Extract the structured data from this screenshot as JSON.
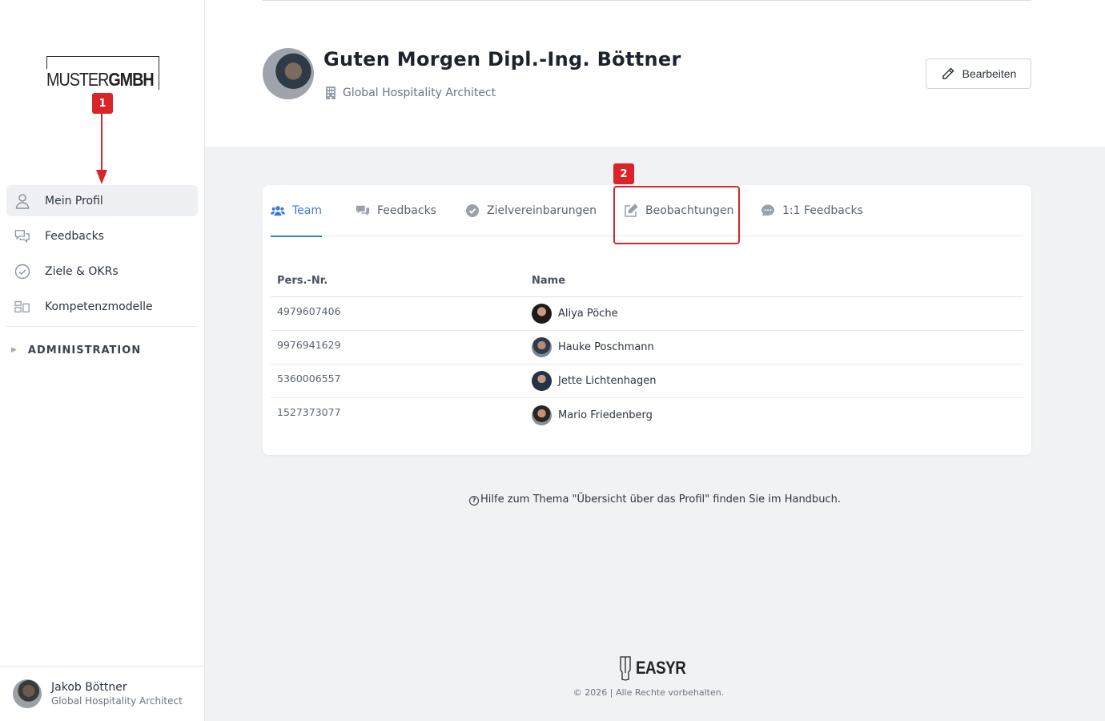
{
  "sidebar": {
    "logo": {
      "part1": "MUSTER",
      "part2": "GMBH"
    },
    "items": [
      {
        "label": "Mein Profil",
        "icon": "user-icon",
        "active": true
      },
      {
        "label": "Feedbacks",
        "icon": "chat-bubbles-icon",
        "active": false
      },
      {
        "label": "Ziele & OKRs",
        "icon": "check-circle-icon",
        "active": false
      },
      {
        "label": "Kompetenzmodelle",
        "icon": "model-blocks-icon",
        "active": false
      }
    ],
    "admin_label": "ADMINISTRATION",
    "user": {
      "name": "Jakob Böttner",
      "role": "Global Hospitality Architect"
    }
  },
  "header": {
    "greeting": "Guten Morgen Dipl.-Ing. Böttner",
    "role": "Global Hospitality Architect",
    "edit_label": "Bearbeiten"
  },
  "tabs": [
    {
      "label": "Team",
      "icon": "users-icon",
      "active": true
    },
    {
      "label": "Feedbacks",
      "icon": "comments-icon",
      "active": false
    },
    {
      "label": "Zielvereinbarungen",
      "icon": "check-circle-icon",
      "active": false
    },
    {
      "label": "Beobachtungen",
      "icon": "edit-icon",
      "active": false
    },
    {
      "label": "1:1 Feedbacks",
      "icon": "comment-dots-icon",
      "active": false
    }
  ],
  "table": {
    "headers": {
      "pers_nr": "Pers.-Nr.",
      "name": "Name"
    },
    "rows": [
      {
        "pers_nr": "4979607406",
        "name": "Aliya Pöche"
      },
      {
        "pers_nr": "9976941629",
        "name": "Hauke Poschmann"
      },
      {
        "pers_nr": "5360006557",
        "name": "Jette Lichtenhagen"
      },
      {
        "pers_nr": "1527373077",
        "name": "Mario Friedenberg"
      }
    ]
  },
  "help_text": "Hilfe zum Thema \"Übersicht über das Profil\" finden Sie im Handbuch.",
  "footer": {
    "brand": "EASYR",
    "copyright": "© 2026 | Alle Rechte vorbehalten."
  },
  "annotations": {
    "badge1": "1",
    "badge2": "2"
  },
  "colors": {
    "accent": "#3a7bd5",
    "annotation": "#d9252a"
  }
}
